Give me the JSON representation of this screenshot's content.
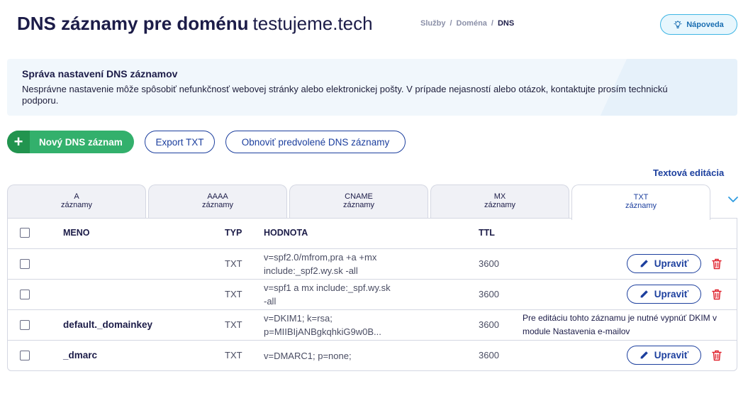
{
  "header": {
    "title": "DNS záznamy pre doménu",
    "domain": "testujeme.tech",
    "breadcrumb": [
      "Služby",
      "Doména",
      "DNS"
    ],
    "breadcrumb_sep": "/",
    "help_label": "Nápoveda"
  },
  "info": {
    "title": "Správa nastavení DNS záznamov",
    "text": "Nesprávne nastavenie môže spôsobiť nefunkčnosť webovej stránky alebo elektronickej pošty. V prípade nejasností alebo otázok, kontaktujte prosím technickú podporu."
  },
  "actions": {
    "new_plus": "+",
    "new_label": "Nový DNS záznam",
    "export_label": "Export TXT",
    "restore_label": "Obnoviť predvolené DNS záznamy",
    "text_edit_label": "Textová editácia"
  },
  "tabs": [
    {
      "type": "A",
      "sub": "záznamy"
    },
    {
      "type": "AAAA",
      "sub": "záznamy"
    },
    {
      "type": "CNAME",
      "sub": "záznamy"
    },
    {
      "type": "MX",
      "sub": "záznamy"
    },
    {
      "type": "TXT",
      "sub": "záznamy"
    }
  ],
  "table": {
    "headers": {
      "name": "MENO",
      "type": "TYP",
      "value": "HODNOTA",
      "ttl": "TTL"
    },
    "edit_label": "Upraviť",
    "rows": [
      {
        "name": "",
        "type": "TXT",
        "value1": "v=spf2.0/mfrom,pra +a +mx",
        "value2": "include:_spf2.wy.sk -all",
        "ttl": "3600"
      },
      {
        "name": "",
        "type": "TXT",
        "value1": "v=spf1 a mx include:_spf.wy.sk",
        "value2": "-all",
        "ttl": "3600"
      },
      {
        "name": "default._domainkey",
        "type": "TXT",
        "value1": "v=DKIM1; k=rsa;",
        "value2": "p=MIIBIjANBgkqhkiG9w0B...",
        "ttl": "3600",
        "note1": "Pre editáciu tohto záznamu je nutné vypnúť DKIM v",
        "note2": "module Nastavenia e-mailov"
      },
      {
        "name": "_dmarc",
        "type": "TXT",
        "value1": "v=DMARC1; p=none;",
        "ttl": "3600"
      }
    ]
  },
  "colors": {
    "accent": "#1c3f9e",
    "green": "#33b06c",
    "delete": "#e0242f",
    "help": "#3fb6e4"
  }
}
